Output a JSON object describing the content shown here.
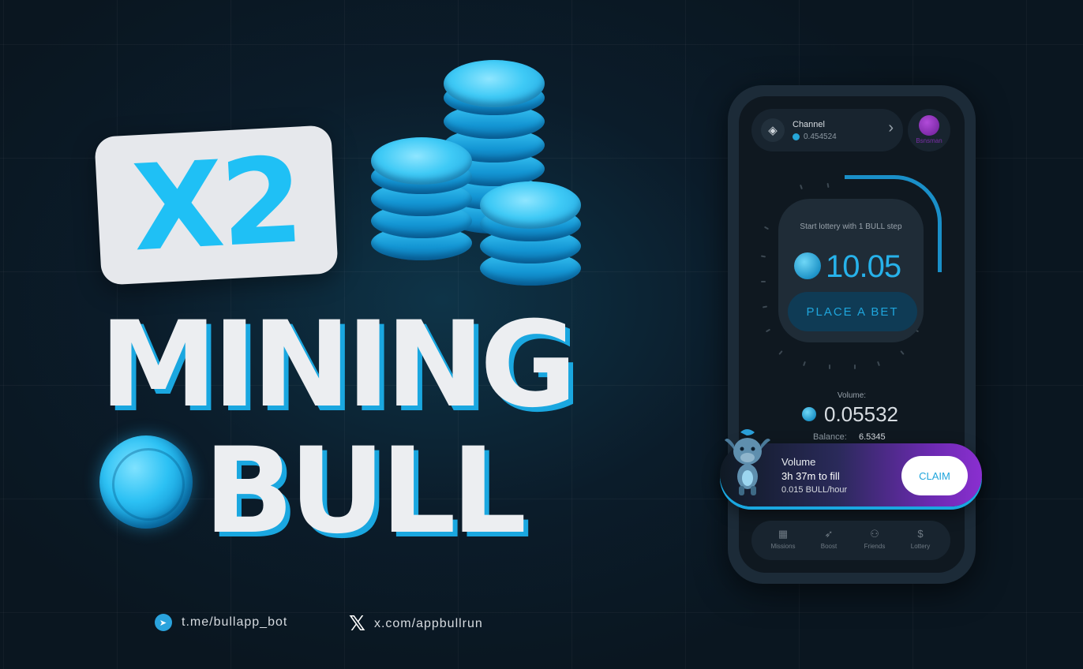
{
  "hero": {
    "multiplier": "X2",
    "line1": "MINING",
    "line2": "BULL"
  },
  "phone": {
    "channel": {
      "title": "Channel",
      "value": "0.454524"
    },
    "profile": {
      "name": "Bsnsman"
    },
    "lottery": {
      "label": "Start lottery with 1 BULL step",
      "amount": "10.05",
      "bet_label": "PLACE A BET"
    },
    "volume": {
      "label": "Volume:",
      "value": "0.05532"
    },
    "balance": {
      "label": "Balance:",
      "value": "6.5345"
    },
    "claim": {
      "title": "Volume",
      "time": "3h 37m to fill",
      "rate": "0.015 BULL/hour",
      "button": "CLAIM"
    },
    "tabs": [
      {
        "label": "Missions",
        "icon": "missions-icon"
      },
      {
        "label": "Boost",
        "icon": "rocket-icon"
      },
      {
        "label": "Friends",
        "icon": "friends-icon"
      },
      {
        "label": "Lottery",
        "icon": "dollar-icon"
      }
    ]
  },
  "footer": {
    "telegram": "t.me/bullapp_bot",
    "x": "x.com/appbullrun"
  },
  "colors": {
    "accent": "#1fc0f5",
    "purple": "#8a2fd0",
    "bg": "#0b1c2a"
  }
}
